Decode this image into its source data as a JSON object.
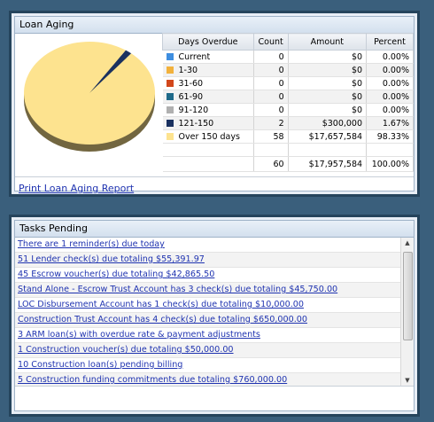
{
  "loan_aging": {
    "title": "Loan Aging",
    "columns": [
      "Days Overdue",
      "Count",
      "Amount",
      "Percent"
    ],
    "rows": [
      {
        "label": "Current",
        "count": "0",
        "amount": "$0",
        "percent": "0.00%",
        "color": "#3e8ee0"
      },
      {
        "label": "1-30",
        "count": "0",
        "amount": "$0",
        "percent": "0.00%",
        "color": "#f2b13c"
      },
      {
        "label": "31-60",
        "count": "0",
        "amount": "$0",
        "percent": "0.00%",
        "color": "#d2471b"
      },
      {
        "label": "61-90",
        "count": "0",
        "amount": "$0",
        "percent": "0.00%",
        "color": "#1f6a8a"
      },
      {
        "label": "91-120",
        "count": "0",
        "amount": "$0",
        "percent": "0.00%",
        "color": "#b0b0b0"
      },
      {
        "label": "121-150",
        "count": "2",
        "amount": "$300,000",
        "percent": "1.67%",
        "color": "#1a3160"
      },
      {
        "label": "Over 150 days",
        "count": "58",
        "amount": "$17,657,584",
        "percent": "98.33%",
        "color": "#fde38f"
      }
    ],
    "totals": {
      "count": "60",
      "amount": "$17,957,584",
      "percent": "100.00%"
    },
    "print_link": "Print Loan Aging Report"
  },
  "chart_data": {
    "type": "pie",
    "categories": [
      "Current",
      "1-30",
      "31-60",
      "61-90",
      "91-120",
      "121-150",
      "Over 150 days"
    ],
    "values": [
      0,
      0,
      0,
      0,
      0,
      1.67,
      98.33
    ],
    "colors": [
      "#3e8ee0",
      "#f2b13c",
      "#d2471b",
      "#1f6a8a",
      "#b0b0b0",
      "#1a3160",
      "#fde38f"
    ]
  },
  "tasks": {
    "title": "Tasks Pending",
    "items": [
      "There are 1 reminder(s) due today",
      "51 Lender check(s) due totaling $55,391.97",
      "45 Escrow voucher(s) due totaling $42,865.50",
      "Stand Alone - Escrow Trust Account has 3 check(s) due totaling $45,750.00",
      "LOC Disbursement Account has 1 check(s) due totaling $10,000.00",
      "Construction Trust Account has 4 check(s) due totaling $650,000.00",
      "3 ARM loan(s) with overdue rate & payment adjustments",
      "1 Construction voucher(s) due totaling $50,000.00",
      "10 Construction loan(s) pending billing",
      "5 Construction funding commitments due totaling $760,000.00"
    ]
  }
}
